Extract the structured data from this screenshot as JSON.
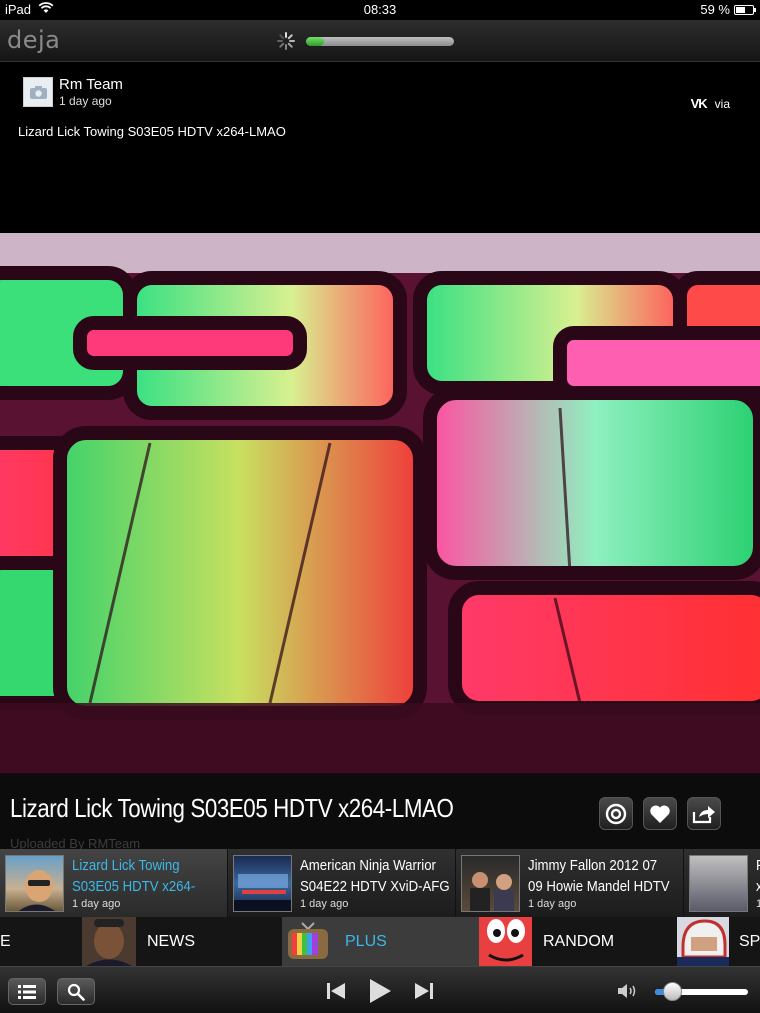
{
  "status_bar": {
    "carrier": "iPad",
    "time": "08:33",
    "battery_percent_label": "59 %",
    "battery_level": 0.59
  },
  "app": {
    "logo": "deja",
    "load_progress": 0.12
  },
  "post": {
    "author": "Rm Team",
    "posted_at": "1 day ago",
    "source_icon": "vk-icon",
    "via_label": "via",
    "text": "Lizard Lick Towing S03E05 HDTV x264-LMAO"
  },
  "video": {
    "title": "Lizard Lick Towing S03E05 HDTV x264-LMAO",
    "uploaded_by": "Uploaded By RMTeam",
    "actions": [
      "camera-icon",
      "heart-icon",
      "share-icon"
    ]
  },
  "related": [
    {
      "title": "Lizard Lick Towing\nS03E05 HDTV x264-",
      "age": "1 day ago",
      "active": true
    },
    {
      "title": "American Ninja Warrior\nS04E22 HDTV XviD-AFG",
      "age": "1 day ago",
      "active": false
    },
    {
      "title": "Jimmy Fallon 2012 07\n09 Howie Mandel HDTV",
      "age": "1 day ago",
      "active": false
    },
    {
      "title": "F\nx",
      "age": "1",
      "active": false
    }
  ],
  "channels": [
    {
      "label": "E"
    },
    {
      "label": "NEWS"
    },
    {
      "label": "PLUS",
      "active": true
    },
    {
      "label": "RANDOM"
    },
    {
      "label": "SP"
    }
  ],
  "toolbar": {
    "list_icon": "list-icon",
    "search_icon": "search-icon",
    "prev_icon": "skip-back-icon",
    "play_icon": "play-icon",
    "next_icon": "skip-forward-icon",
    "volume_icon": "speaker-icon",
    "volume_level": 0.18
  },
  "colors": {
    "accent": "#3cb8e8",
    "progress": "#4cc043"
  }
}
